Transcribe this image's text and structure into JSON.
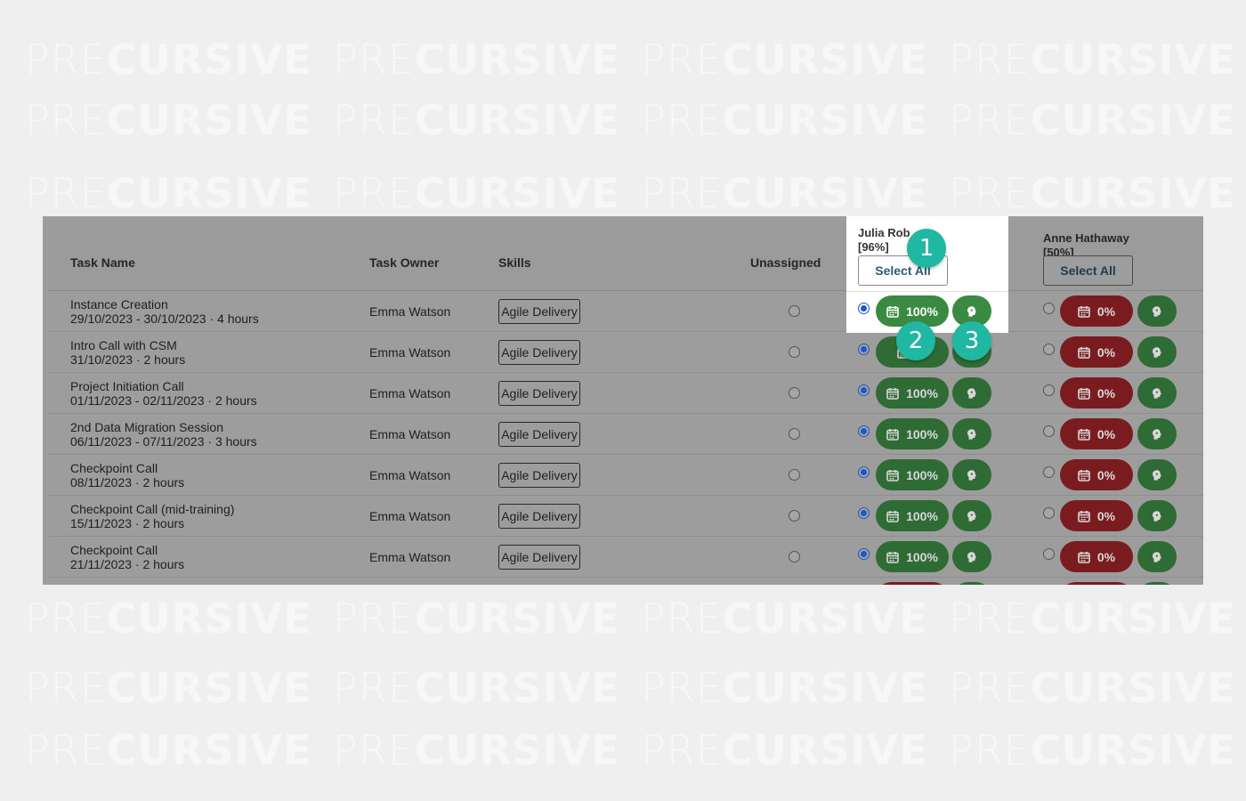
{
  "watermark": {
    "light": "PRE",
    "bold": "CURSIVE"
  },
  "colors": {
    "background": "#efefef",
    "panel": "#9d9d9d",
    "green_pill": "#2f6b35",
    "red_pill": "#7a1c1f",
    "highlight_green": "#3b8a41",
    "badge": "#20b7a3",
    "radio_selected": "#1a56d6"
  },
  "header": {
    "task_name": "Task Name",
    "task_owner": "Task Owner",
    "skills": "Skills",
    "unassigned": "Unassigned"
  },
  "resources": [
    {
      "name": "Julia Rob",
      "pct": "[96%]",
      "select_all": "Select All"
    },
    {
      "name": "Anne Hathaway",
      "pct": "[50%]",
      "select_all": "Select All"
    }
  ],
  "icons": {
    "calendar": "calendar-icon",
    "skills": "brain-icon"
  },
  "rows": [
    {
      "name": "Instance Creation",
      "dates": "29/10/2023 - 30/10/2023 · 4 hours",
      "owner": "Emma Watson",
      "skill": "Agile Delivery",
      "julia": "100%",
      "anne": "0%"
    },
    {
      "name": "Intro Call with CSM",
      "dates": "31/10/2023 · 2 hours",
      "owner": "Emma Watson",
      "skill": "Agile Delivery",
      "julia": "%",
      "anne": "0%"
    },
    {
      "name": "Project Initiation Call",
      "dates": "01/11/2023 - 02/11/2023 · 2 hours",
      "owner": "Emma Watson",
      "skill": "Agile Delivery",
      "julia": "100%",
      "anne": "0%"
    },
    {
      "name": "2nd Data Migration Session",
      "dates": "06/11/2023 - 07/11/2023 · 3 hours",
      "owner": "Emma Watson",
      "skill": "Agile Delivery",
      "julia": "100%",
      "anne": "0%"
    },
    {
      "name": "Checkpoint Call",
      "dates": "08/11/2023 · 2 hours",
      "owner": "Emma Watson",
      "skill": "Agile Delivery",
      "julia": "100%",
      "anne": "0%"
    },
    {
      "name": "Checkpoint Call (mid-training)",
      "dates": "15/11/2023 · 2 hours",
      "owner": "Emma Watson",
      "skill": "Agile Delivery",
      "julia": "100%",
      "anne": "0%"
    },
    {
      "name": "Checkpoint Call",
      "dates": "21/11/2023 · 2 hours",
      "owner": "Emma Watson",
      "skill": "Agile Delivery",
      "julia": "100%",
      "anne": "0%"
    }
  ],
  "callouts": [
    "1",
    "2",
    "3"
  ]
}
